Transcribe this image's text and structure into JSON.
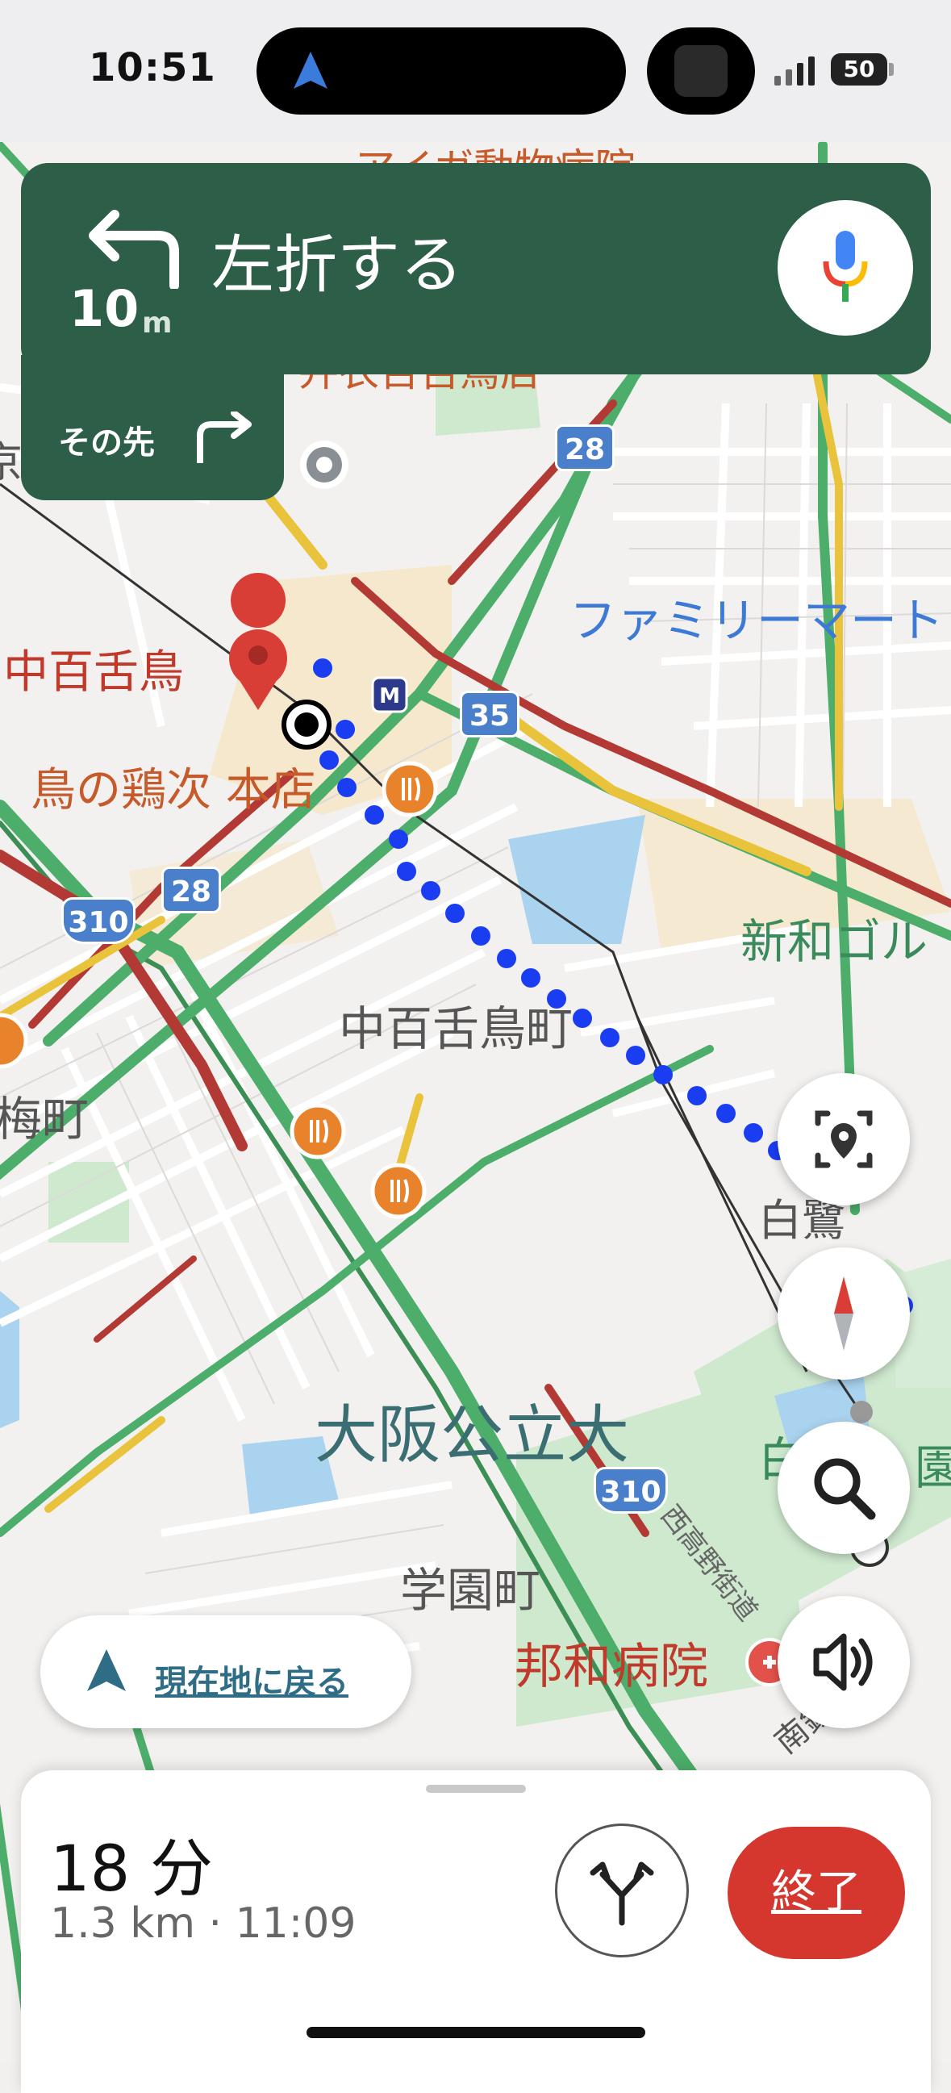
{
  "status_bar": {
    "time": "10:51",
    "battery": "50"
  },
  "navigation": {
    "distance_value": "10",
    "distance_unit": "m",
    "instruction": "左折する",
    "then_label": "その先",
    "turn_icon": "turn-left-icon",
    "then_icon": "turn-right-icon"
  },
  "map": {
    "labels": {
      "top_cut": "アイガ動物病院",
      "top_cut2": "弁衣百舌鳥店",
      "station": "中百舌鳥",
      "restaurant": "鳥の鶏次 本店",
      "familymart": "ファミリーマート",
      "town1": "中百舌鳥町",
      "town2": "梅町",
      "golf": "新和ゴル",
      "shirasagi": "白鷺",
      "university": "大阪公立大",
      "gakuen": "学園町",
      "hospital": "邦和病院",
      "road_street": "西高野街道",
      "left_cut": "京",
      "park_cut": "白",
      "park_cut2": "園",
      "railway_cut": "南鉄"
    },
    "road_badges": [
      "28",
      "35",
      "28",
      "310",
      "310"
    ]
  },
  "recenter": {
    "label": "現在地に戻る"
  },
  "bottom_sheet": {
    "eta_minutes": "18 分",
    "eta_detail": "1.3 km · 11:09",
    "end_label": "終了"
  }
}
